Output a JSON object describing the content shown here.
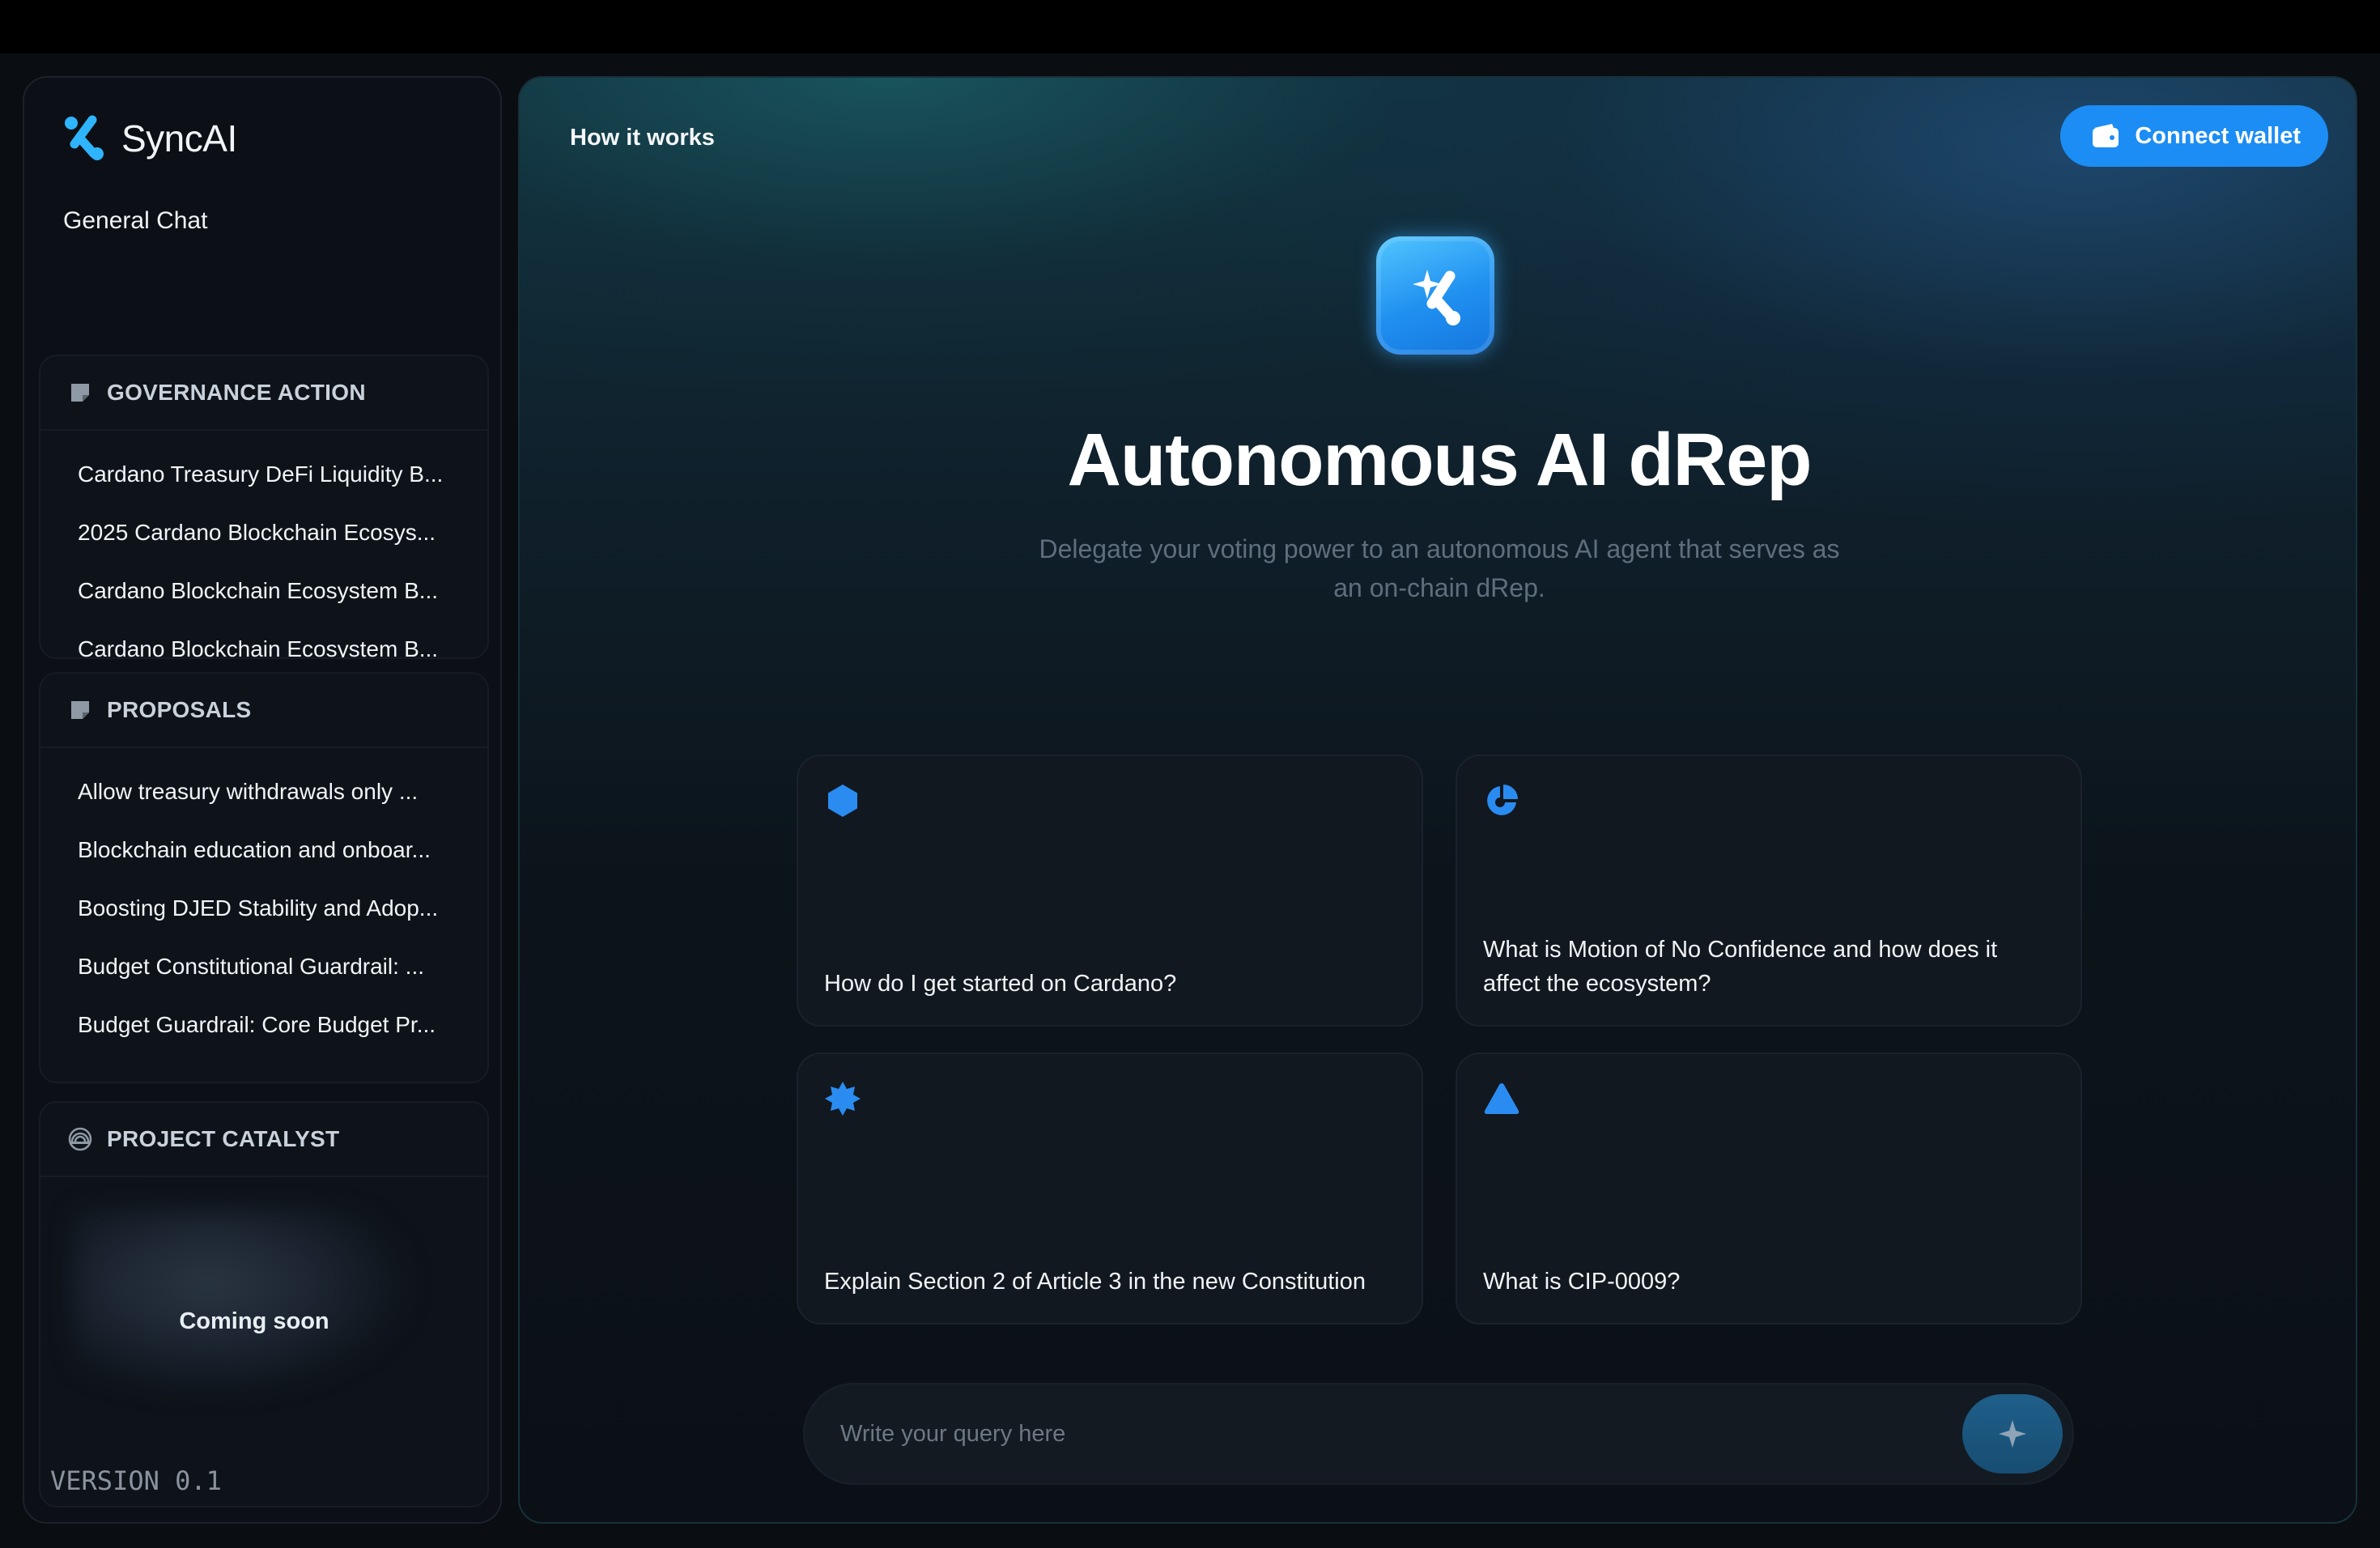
{
  "app": {
    "brand": "SyncAI",
    "accent_color": "#1c8df5"
  },
  "sidebar": {
    "general_chat": "General Chat",
    "governance": {
      "title": "GOVERNANCE ACTION",
      "icon": "sticky-note-icon",
      "items": [
        "Cardano Treasury DeFi Liquidity B...",
        "2025 Cardano Blockchain Ecosys...",
        "Cardano Blockchain Ecosystem B...",
        "Cardano Blockchain Ecosystem B..."
      ]
    },
    "proposals": {
      "title": "PROPOSALS",
      "icon": "sticky-note-icon",
      "items": [
        "Allow treasury withdrawals only ...",
        "Blockchain education and onboar...",
        "Boosting DJED Stability and Adop...",
        "Budget Constitutional Guardrail: ...",
        "Budget Guardrail: Core Budget Pr..."
      ]
    },
    "catalyst": {
      "title": "PROJECT CATALYST",
      "icon": "rainbow-icon",
      "status": "Coming soon"
    },
    "version": "VERSION 0.1"
  },
  "header": {
    "how_it_works": "How it works",
    "connect_wallet": "Connect wallet"
  },
  "hero": {
    "title": "Autonomous AI dRep",
    "subtitle": "Delegate your voting power to an autonomous AI agent that serves as an on-chain dRep."
  },
  "suggestions": [
    {
      "icon": "hexagon-icon",
      "text": "How do I get started on Cardano?"
    },
    {
      "icon": "pie-chart-icon",
      "text": "What is Motion of No Confidence and how does it affect the ecosystem?"
    },
    {
      "icon": "star-badge-icon",
      "text": "Explain Section 2 of Article 3 in the new Constitution"
    },
    {
      "icon": "triangle-icon",
      "text": "What is CIP-0009?"
    }
  ],
  "query": {
    "placeholder": "Write your query here",
    "value": ""
  }
}
